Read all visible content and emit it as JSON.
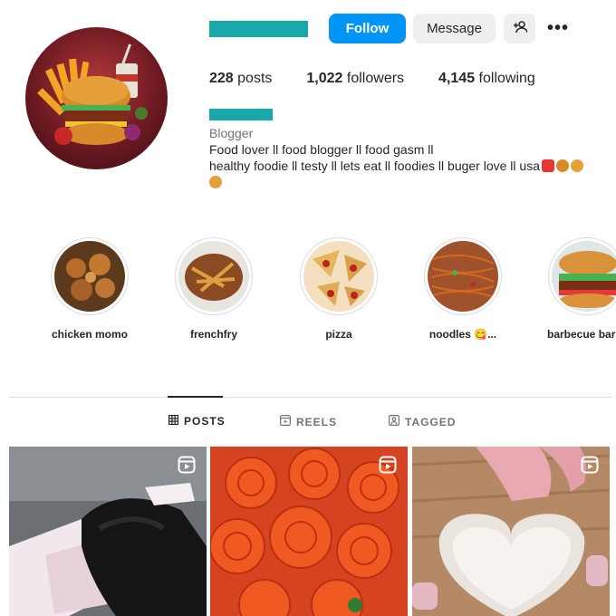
{
  "profile": {
    "category": "Blogger",
    "bio_line1": "Food lover ll food blogger ll food gasm ll",
    "bio_line2": "healthy foodie ll testy ll lets eat ll foodies ll buger love ll usa"
  },
  "actions": {
    "follow": "Follow",
    "message": "Message",
    "add_user_icon": "add-user-icon",
    "more": "•••"
  },
  "stats": [
    {
      "value": "228",
      "label": "posts"
    },
    {
      "value": "1,022",
      "label": "followers"
    },
    {
      "value": "4,145",
      "label": "following"
    }
  ],
  "highlights": [
    {
      "label": "chicken momo"
    },
    {
      "label": "frenchfry"
    },
    {
      "label": "pizza"
    },
    {
      "label": "noodles 😋..."
    },
    {
      "label": "barbecue bar"
    }
  ],
  "tabs": [
    {
      "label": "POSTS",
      "icon": "grid-icon"
    },
    {
      "label": "REELS",
      "icon": "reels-icon"
    },
    {
      "label": "TAGGED",
      "icon": "tagged-icon"
    }
  ],
  "colors": {
    "accent": "#0095f6",
    "redacted": "#19a7a9"
  }
}
